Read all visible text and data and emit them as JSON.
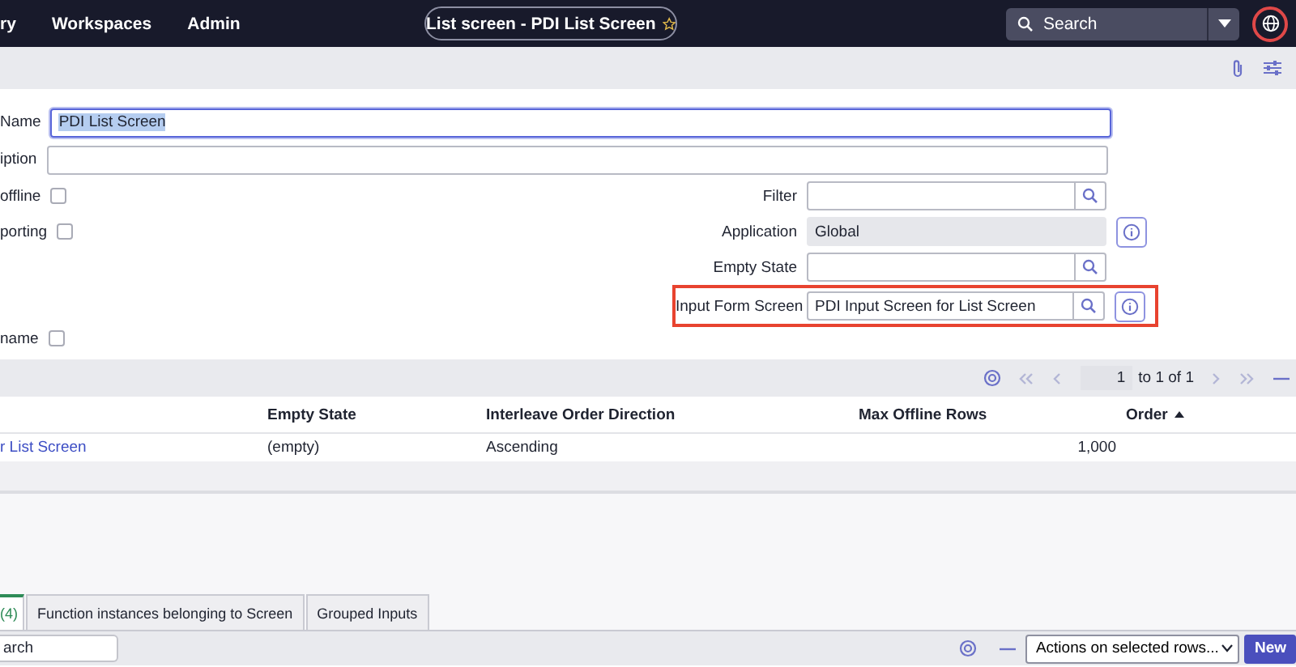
{
  "header": {
    "nav": [
      "ry",
      "Workspaces",
      "Admin"
    ],
    "title": "List screen - PDI List Screen",
    "favorite": false,
    "search": {
      "placeholder": "Search"
    }
  },
  "form": {
    "name": {
      "label": "Name",
      "value": "PDI List Screen",
      "focused": true,
      "text_selected": true
    },
    "description": {
      "label": "iption"
    },
    "checkboxes": [
      {
        "label": "offline",
        "checked": false
      },
      {
        "label": "porting",
        "checked": false
      },
      {
        "label": "name",
        "checked": false
      }
    ],
    "fields": [
      {
        "label": "Filter",
        "lookup": true,
        "info": false,
        "read_only": false,
        "highlighted": false
      },
      {
        "label": "Application",
        "value": "Global",
        "lookup": false,
        "info": true,
        "read_only": true,
        "highlighted": false
      },
      {
        "label": "Empty State",
        "lookup": true,
        "info": false,
        "read_only": false,
        "highlighted": false
      },
      {
        "label": "Input Form Screen",
        "value": "PDI Input Screen for List Screen",
        "lookup": true,
        "info": true,
        "read_only": false,
        "highlighted": true
      }
    ]
  },
  "list": {
    "pagination": {
      "page": "1",
      "range": "to 1 of 1"
    },
    "columns": [
      {
        "label": "Empty State",
        "sorted": false
      },
      {
        "label": "Interleave Order Direction",
        "sorted": false
      },
      {
        "label": "Max Offline Rows",
        "sorted": false
      },
      {
        "label": "Order",
        "sorted": true
      }
    ],
    "rows": [
      {
        "link": "r List Screen",
        "empty_state": "(empty)",
        "interleave_order_direction": "Ascending",
        "max_offline_rows": "1,000"
      }
    ]
  },
  "related_tabs": [
    {
      "label": "(4)",
      "selected": true
    },
    {
      "label": "Function instances belonging to Screen",
      "selected": false
    },
    {
      "label": "Grouped Inputs",
      "selected": false
    }
  ],
  "related_bar": {
    "search": {
      "placeholder": "arch"
    },
    "actions": "Actions on selected rows...",
    "new_button": "New"
  }
}
